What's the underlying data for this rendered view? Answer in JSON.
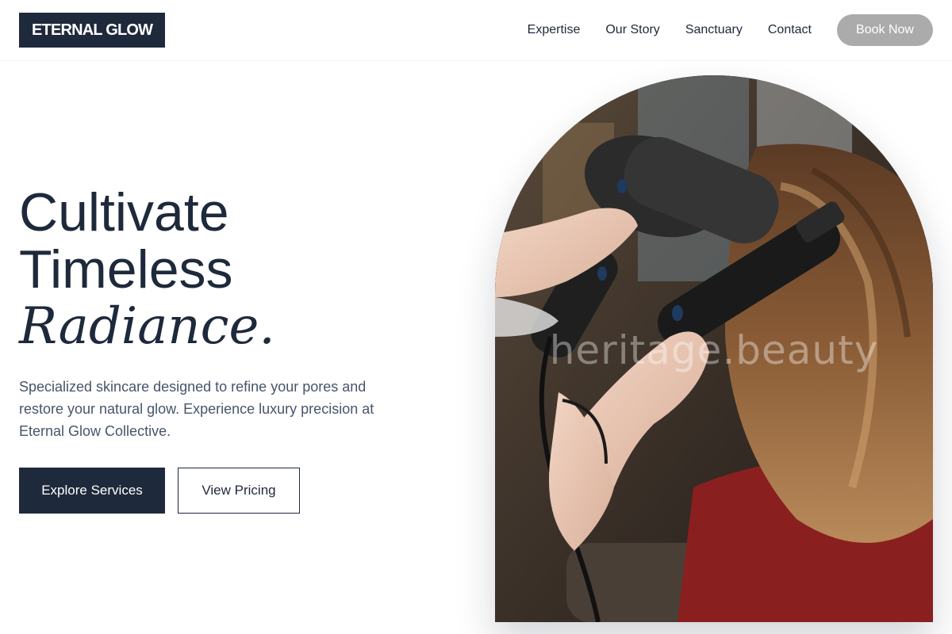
{
  "brand": {
    "logo_text": "ETERNAL GLOW"
  },
  "nav": {
    "links": [
      "Expertise",
      "Our Story",
      "Sanctuary",
      "Contact"
    ],
    "cta_label": "Book Now"
  },
  "hero": {
    "headline_line1": "Cultivate",
    "headline_line2": "Timeless",
    "headline_accent": "Radiance.",
    "description": "Specialized skincare designed to refine your pores and restore your natural glow. Experience luxury precision at Eternal Glow Collective.",
    "primary_button": "Explore Services",
    "secondary_button": "View Pricing",
    "image_watermark": "heritage.beauty"
  },
  "colors": {
    "primary": "#1e293b",
    "muted_text": "#475569",
    "cta_background": "#ababab",
    "background": "#ffffff"
  },
  "icons": []
}
